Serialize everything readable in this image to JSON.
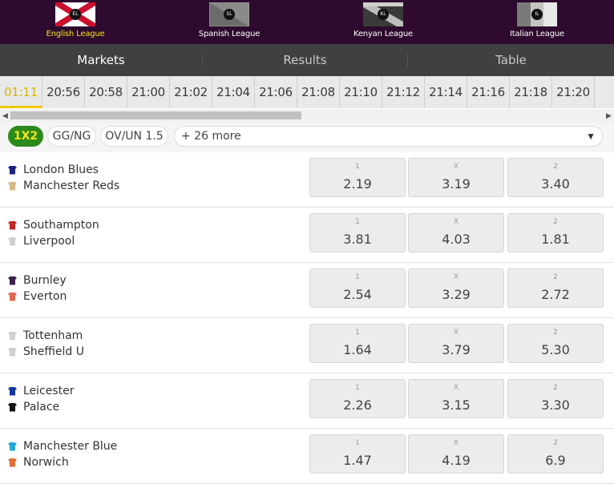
{
  "leagues": [
    {
      "label": "English League",
      "badge": "EL",
      "active": true
    },
    {
      "label": "Spanish League",
      "badge": "SL",
      "active": false
    },
    {
      "label": "Kenyan League",
      "badge": "KL",
      "active": false
    },
    {
      "label": "Italian League",
      "badge": "IL",
      "active": false
    }
  ],
  "tabs": [
    {
      "label": "Markets",
      "active": true
    },
    {
      "label": "Results",
      "active": false
    },
    {
      "label": "Table",
      "active": false
    }
  ],
  "times": [
    "01:11",
    "20:56",
    "20:58",
    "21:00",
    "21:02",
    "21:04",
    "21:06",
    "21:08",
    "21:10",
    "21:12",
    "21:14",
    "21:16",
    "21:18",
    "21:20"
  ],
  "active_time": "01:11",
  "markets": {
    "chips": [
      "1X2",
      "GG/NG",
      "OV/UN 1.5"
    ],
    "active": "1X2",
    "more_label": "+ 26 more"
  },
  "odds_labels": [
    "1",
    "X",
    "2"
  ],
  "matches": [
    {
      "home": "London Blues",
      "away": "Manchester Reds",
      "home_color": "#1a237e",
      "away_color": "#d8b88a",
      "odds": [
        "2.19",
        "3.19",
        "3.40"
      ]
    },
    {
      "home": "Southampton",
      "away": "Liverpool",
      "home_color": "#c62828",
      "away_color": "#cfcfcf",
      "odds": [
        "3.81",
        "4.03",
        "1.81"
      ]
    },
    {
      "home": "Burnley",
      "away": "Everton",
      "home_color": "#3d1f4a",
      "away_color": "#e06a50",
      "odds": [
        "2.54",
        "3.29",
        "2.72"
      ]
    },
    {
      "home": "Tottenham",
      "away": "Sheffield U",
      "home_color": "#d0d0d0",
      "away_color": "#cfcfcf",
      "odds": [
        "1.64",
        "3.79",
        "5.30"
      ]
    },
    {
      "home": "Leicester",
      "away": "Palace",
      "home_color": "#1538a0",
      "away_color": "#111111",
      "odds": [
        "2.26",
        "3.15",
        "3.30"
      ]
    },
    {
      "home": "Manchester Blue",
      "away": "Norwich",
      "home_color": "#29a8d8",
      "away_color": "#e0703a",
      "odds": [
        "1.47",
        "4.19",
        "6.9"
      ]
    }
  ],
  "colors": {
    "accent": "#f6e51f",
    "header_bg": "#2e0a2e",
    "chip_active": "#2a8a1a"
  },
  "icons": [
    "scroll-left-icon",
    "scroll-right-icon",
    "dropdown-caret-icon",
    "team-shirt-icon",
    "league-flag-icon"
  ]
}
